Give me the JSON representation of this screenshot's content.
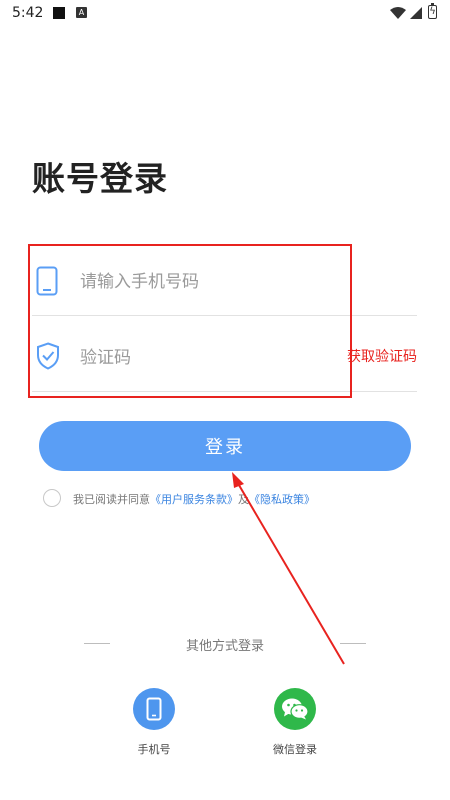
{
  "status_bar": {
    "time": "5:42",
    "notification_letter": "A"
  },
  "title": "账号登录",
  "phone_field": {
    "placeholder": "请输入手机号码",
    "value": ""
  },
  "code_field": {
    "placeholder": "验证码",
    "value": "",
    "get_code_label": "获取验证码"
  },
  "login_button_label": "登录",
  "agreement": {
    "prefix": "我已阅读并同意",
    "terms_link": "《用户服务条款》",
    "and": "及",
    "privacy_link": "《隐私政策》",
    "checked": false
  },
  "other_methods": {
    "label": "其他方式登录",
    "options": [
      {
        "label": "手机号",
        "icon": "phone-icon",
        "color": "#4e96ee"
      },
      {
        "label": "微信登录",
        "icon": "wechat-icon",
        "color": "#2fb84a"
      }
    ]
  },
  "colors": {
    "accent": "#5a9ef5",
    "highlight_red": "#e8231f"
  }
}
